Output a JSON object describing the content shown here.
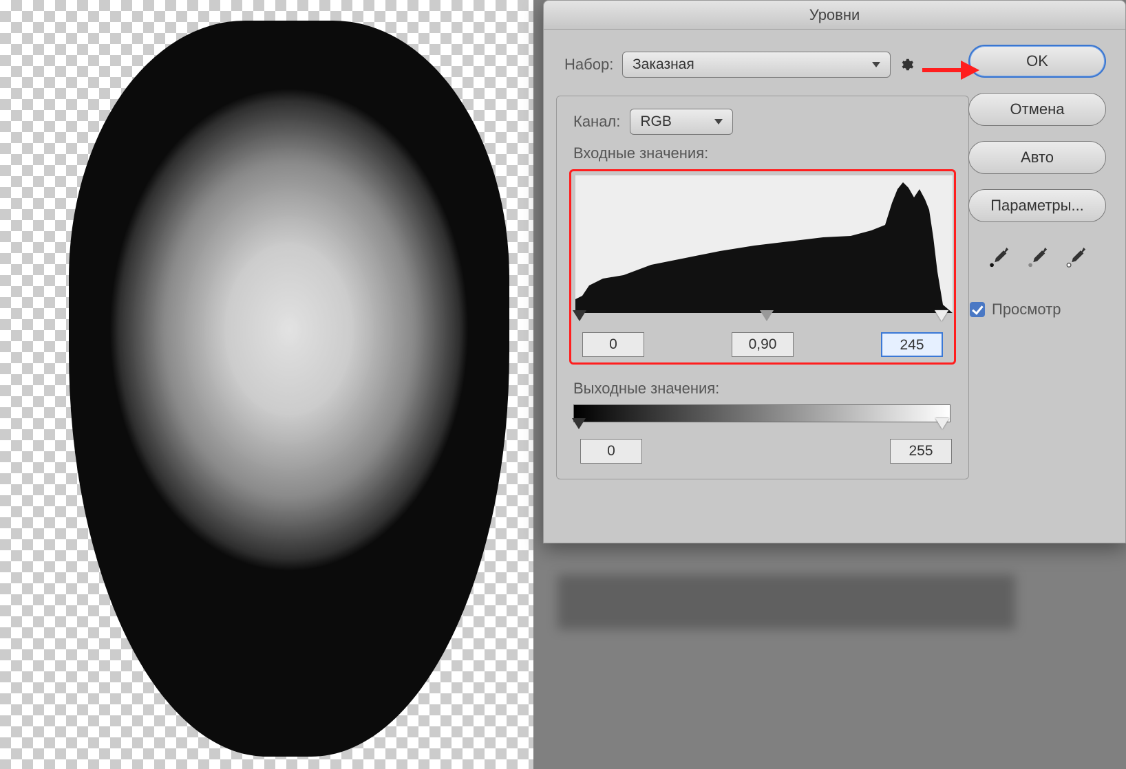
{
  "dialog": {
    "title": "Уровни",
    "preset_label": "Набор:",
    "preset_value": "Заказная",
    "channel_label": "Канал:",
    "channel_value": "RGB",
    "input_label": "Входные значения:",
    "input_black": "0",
    "input_gamma": "0,90",
    "input_white": "245",
    "output_label": "Выходные значения:",
    "output_black": "0",
    "output_white": "255"
  },
  "buttons": {
    "ok": "OK",
    "cancel": "Отмена",
    "auto": "Авто",
    "options": "Параметры..."
  },
  "preview_label": "Просмотр"
}
